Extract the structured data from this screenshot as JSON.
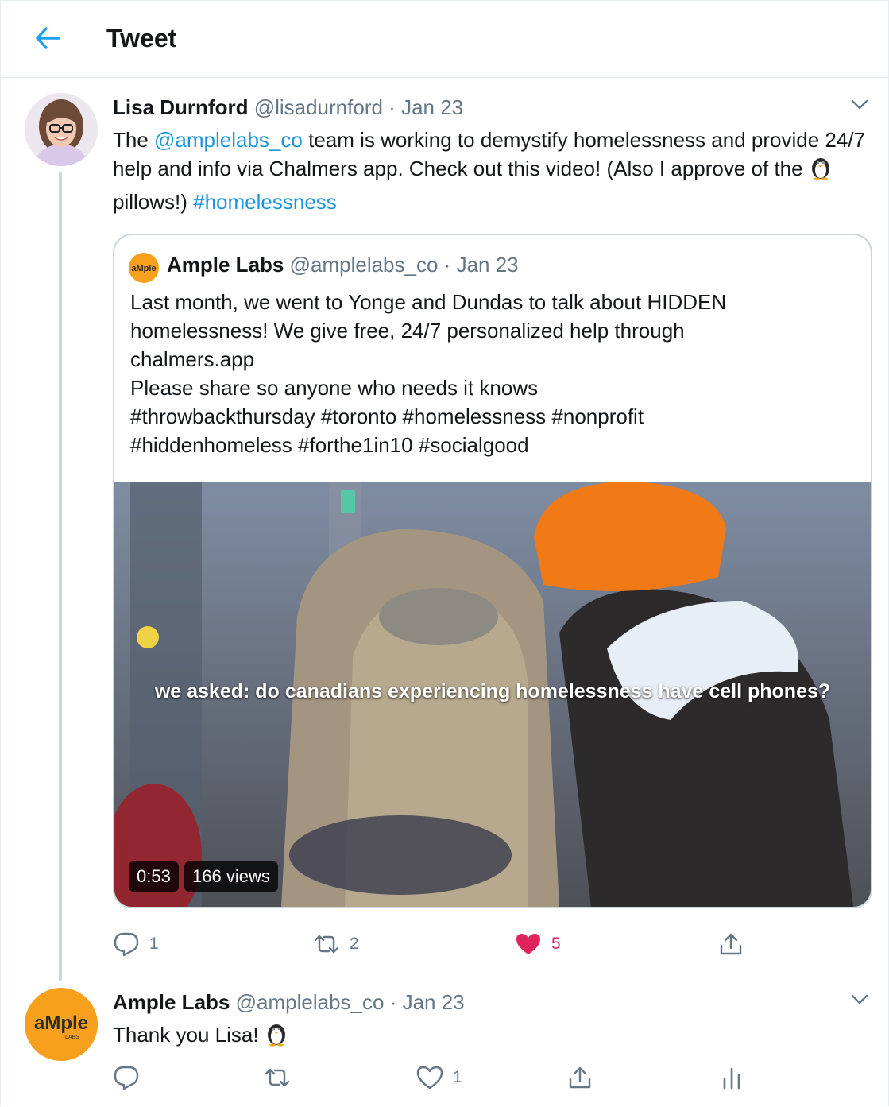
{
  "header": {
    "title": "Tweet"
  },
  "main_tweet": {
    "author_name": "Lisa Durnford",
    "handle": "@lisadurnford",
    "separator": "·",
    "date": "Jan 23",
    "text": {
      "part1": "The ",
      "mention": "@amplelabs_co",
      "part2": " team is working to demystify homelessness and provide 24/7 help and info via Chalmers app. Check out this video! (Also I approve of the ",
      "emoji": "penguin",
      "part3": " pillows!) ",
      "hashtag": "#homelessness"
    },
    "quoted": {
      "author_name": "Ample Labs",
      "handle": "@amplelabs_co",
      "separator": "·",
      "date": "Jan 23",
      "lines": [
        "Last month, we went to Yonge and Dundas to talk about HIDDEN",
        "homelessness! We give free, 24/7 personalized help through",
        "chalmers.app",
        "Please share so anyone who needs it knows",
        "#throwbackthursday #toronto #homelessness #nonprofit",
        "#hiddenhomeless #forthe1in10 #socialgood"
      ],
      "video": {
        "caption": "we asked: do canadians experiencing homelessness have cell phones?",
        "duration": "0:53",
        "views": "166 views"
      }
    },
    "actions": {
      "reply_count": "1",
      "retweet_count": "2",
      "like_count": "5",
      "like_color": "#e0245e"
    }
  },
  "reply_tweet": {
    "author_name": "Ample Labs",
    "handle": "@amplelabs_co",
    "separator": "·",
    "date": "Jan 23",
    "text": "Thank you Lisa! ",
    "emoji": "penguin",
    "actions": {
      "like_count": "1"
    }
  },
  "colors": {
    "accent": "#1da1f2",
    "link": "#1b95e0",
    "muted": "#657786",
    "border": "#ccd6dd",
    "brand_orange": "#f7a01d"
  }
}
